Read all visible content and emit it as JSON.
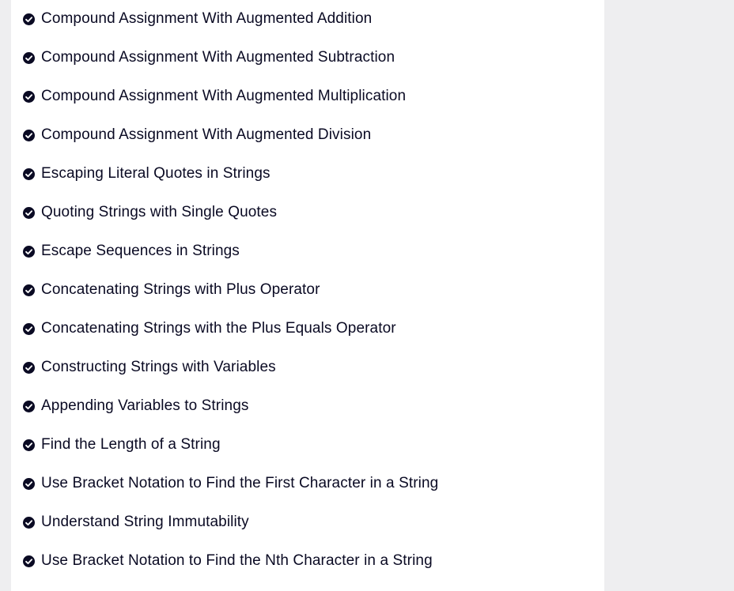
{
  "challenges": {
    "completed_icon": "check-circle-icon",
    "items": [
      {
        "label": "Compound Assignment With Augmented Addition"
      },
      {
        "label": "Compound Assignment With Augmented Subtraction"
      },
      {
        "label": "Compound Assignment With Augmented Multiplication"
      },
      {
        "label": "Compound Assignment With Augmented Division"
      },
      {
        "label": "Escaping Literal Quotes in Strings"
      },
      {
        "label": "Quoting Strings with Single Quotes"
      },
      {
        "label": "Escape Sequences in Strings"
      },
      {
        "label": "Concatenating Strings with Plus Operator"
      },
      {
        "label": "Concatenating Strings with the Plus Equals Operator"
      },
      {
        "label": "Constructing Strings with Variables"
      },
      {
        "label": "Appending Variables to Strings"
      },
      {
        "label": "Find the Length of a String"
      },
      {
        "label": "Use Bracket Notation to Find the First Character in a String"
      },
      {
        "label": "Understand String Immutability"
      },
      {
        "label": "Use Bracket Notation to Find the Nth Character in a String"
      }
    ]
  },
  "colors": {
    "page_background": "#eeeef0",
    "panel_background": "#ffffff",
    "text": "#0a0a23",
    "check": "#0a0a23"
  }
}
